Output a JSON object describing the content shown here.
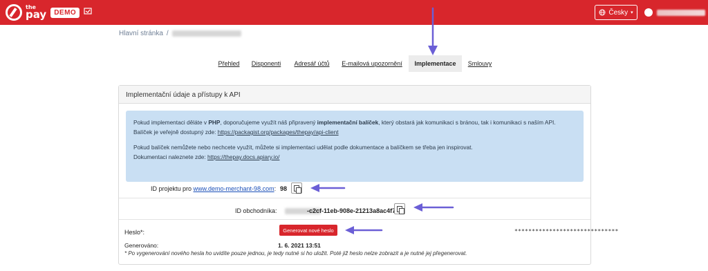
{
  "header": {
    "logo_the": "the",
    "logo_pay": "pay",
    "demo_badge": "DEMO",
    "language_label": "Česky"
  },
  "breadcrumb": {
    "home": "Hlavní stránka",
    "separator": "/"
  },
  "tabs": [
    {
      "label": "Přehled",
      "active": false
    },
    {
      "label": "Disponenti",
      "active": false
    },
    {
      "label": "Adresář účtů",
      "active": false
    },
    {
      "label": "E-mailová upozornění",
      "active": false
    },
    {
      "label": "Implementace",
      "active": true
    },
    {
      "label": "Smlouvy",
      "active": false
    }
  ],
  "card": {
    "title": "Implementační údaje a přístupy k API",
    "info": {
      "p1_a": "Pokud implementaci děláte v ",
      "p1_php": "PHP",
      "p1_b": ", doporučujeme využít náš připravený ",
      "p1_pkg": "implementační balíček",
      "p1_c": ", který obstará jak komunikaci s bránou, tak i komunikaci s naším API. Balíček je veřejně dostupný zde: ",
      "p1_link": "https://packagist.org/packages/thepay/api-client",
      "p2_a": "Pokud balíček nemůžete nebo nechcete využít, můžete si implementaci udělat podle dokumentace a balíčkem se třeba jen inspirovat.",
      "p2_b": "Dokumentaci naleznete zde: ",
      "p2_link": "https://thepay.docs.apiary.io/"
    },
    "project_label": "ID projektu pro ",
    "project_link": "www.demo-merchant-98.com",
    "project_colon": ":",
    "project_id": "98",
    "merchant_label": "ID obchodníka:",
    "merchant_id_suffix": "-c2cf-11eb-908e-21213a8ac4f7",
    "password_label": "Heslo*:",
    "generate_button": "Generovat nové heslo",
    "password_mask": "******************************",
    "generated_label": "Generováno:",
    "generated_date": "1. 6. 2021 13:51",
    "note": "* Po vygenerování nového hesla ho uvidíte pouze jednou, je tedy nutné si ho uložit. Poté již heslo nelze zobrazit a je nutné jej přegenerovat."
  },
  "colors": {
    "brand_red": "#d8262c",
    "info_blue": "#c9dff3",
    "annotation_arrow": "#6b5fd6"
  },
  "icons": [
    "thepay-logo-icon",
    "switch-icon",
    "globe-icon",
    "user-icon",
    "copy-icon",
    "arrow-annotation-icon"
  ]
}
